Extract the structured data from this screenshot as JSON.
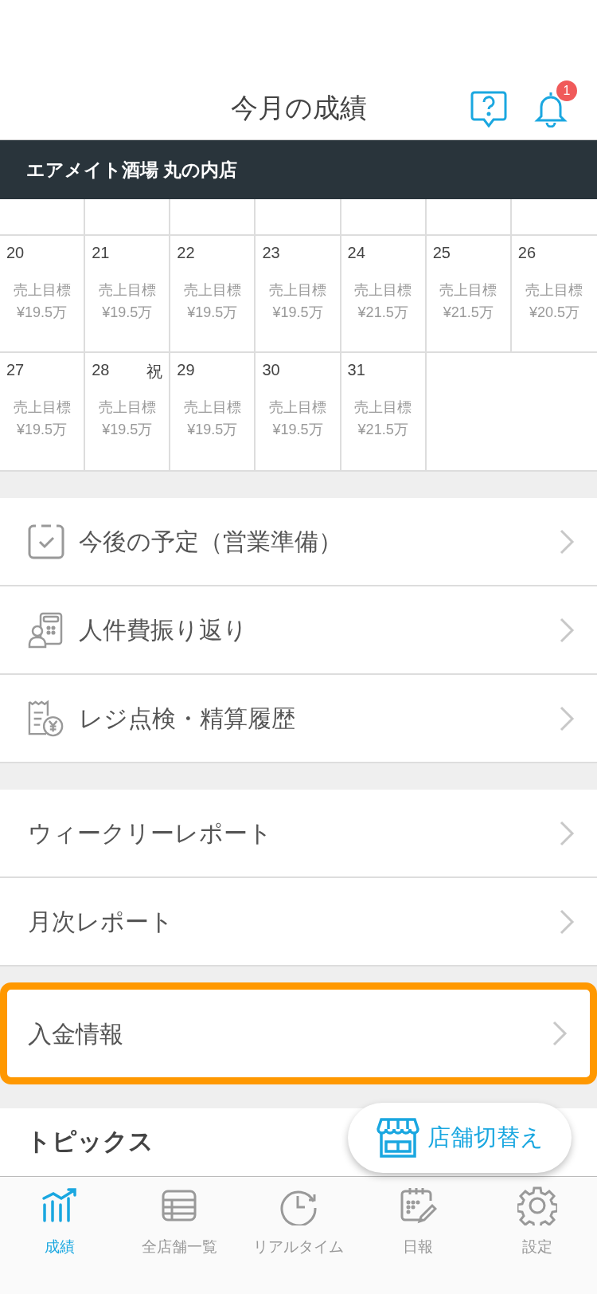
{
  "header": {
    "title": "今月の成績",
    "notification_badge": "1"
  },
  "store_name": "エアメイト酒場 丸の内店",
  "calendar": {
    "weeks": [
      {
        "days": [
          {
            "date": "20",
            "label": "売上目標",
            "target": "¥19.5万"
          },
          {
            "date": "21",
            "label": "売上目標",
            "target": "¥19.5万"
          },
          {
            "date": "22",
            "label": "売上目標",
            "target": "¥19.5万"
          },
          {
            "date": "23",
            "label": "売上目標",
            "target": "¥19.5万"
          },
          {
            "date": "24",
            "label": "売上目標",
            "target": "¥21.5万"
          },
          {
            "date": "25",
            "label": "売上目標",
            "target": "¥21.5万"
          },
          {
            "date": "26",
            "label": "売上目標",
            "target": "¥20.5万"
          }
        ]
      },
      {
        "days": [
          {
            "date": "27",
            "label": "売上目標",
            "target": "¥19.5万"
          },
          {
            "date": "28",
            "holiday_mark": "祝",
            "label": "売上目標",
            "target": "¥19.5万"
          },
          {
            "date": "29",
            "label": "売上目標",
            "target": "¥19.5万"
          },
          {
            "date": "30",
            "label": "売上目標",
            "target": "¥19.5万"
          },
          {
            "date": "31",
            "label": "売上目標",
            "target": "¥21.5万"
          }
        ]
      }
    ]
  },
  "menu_groups": [
    {
      "items": [
        {
          "label": "今後の予定（営業準備）",
          "kind": "schedule",
          "highlighted": false
        },
        {
          "label": "人件費振り返り",
          "kind": "labor",
          "highlighted": false
        },
        {
          "label": "レジ点検・精算履歴",
          "kind": "register",
          "highlighted": false
        }
      ]
    },
    {
      "items": [
        {
          "label": "ウィークリーレポート",
          "kind": "plain",
          "highlighted": false
        },
        {
          "label": "月次レポート",
          "kind": "plain",
          "highlighted": false
        }
      ]
    },
    {
      "items": [
        {
          "label": "入金情報",
          "kind": "plain",
          "highlighted": true
        }
      ]
    }
  ],
  "topics": {
    "title": "トピックス"
  },
  "switch_store_button": "店舗切替え",
  "tabs": [
    {
      "label": "成績",
      "kind": "results",
      "selected": true
    },
    {
      "label": "全店舗一覧",
      "kind": "stores",
      "selected": false
    },
    {
      "label": "リアルタイム",
      "kind": "realtime",
      "selected": false
    },
    {
      "label": "日報",
      "kind": "daily",
      "selected": false
    },
    {
      "label": "設定",
      "kind": "settings",
      "selected": false
    }
  ]
}
